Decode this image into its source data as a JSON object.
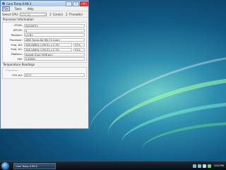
{
  "window": {
    "title": "Core Temp 0.99.3",
    "controls": [
      "–",
      "□",
      "✕"
    ]
  },
  "menu": [
    "File",
    "Tools",
    "Help"
  ],
  "toolbar": {
    "select_cpu_label": "Select CPU:",
    "cpu_value": "CPU #0",
    "cores_count": "2",
    "cores_label": "Core(s)",
    "threads_count": "2",
    "threads_label": "Thread(s)"
  },
  "processor_info": {
    "section_title": "Processor Information",
    "rows": [
      {
        "label": "CPUID:",
        "value": "0x200F31"
      },
      {
        "label": "APICID:",
        "value": "0"
      },
      {
        "label": "Revision:",
        "value": "LG-B1"
      },
      {
        "label": "Processor:",
        "value": "AMD Turion 64 RM-74 (Lion)"
      },
      {
        "label": "Freq. #0:",
        "value": "548.44MHz (199.51 x 2.75)",
        "pct": "37%"
      },
      {
        "label": "Freq. #1:",
        "value": "548.44MHz (199.51 x 2.75)",
        "pct": "31%"
      },
      {
        "label": "Platform:",
        "value": "Socket S1g2 (638 pin)"
      },
      {
        "label": "VID:",
        "value": "0.8000v"
      }
    ]
  },
  "temperature": {
    "section_title": "Temperature Readings",
    "tcase_label": "TCaseMax: -",
    "cpu_label": "CPU #0:",
    "cpu_value": "97°C"
  },
  "taskbar": {
    "task_label": "Core Temp 0.99.3",
    "clock": "3:00 PM"
  }
}
